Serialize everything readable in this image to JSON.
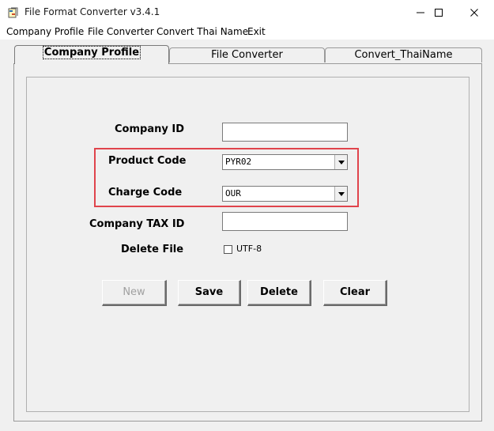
{
  "window": {
    "title": "File Format Converter v3.4.1"
  },
  "menu": [
    "Company Profile",
    "File Converter",
    "Convert Thai Name",
    "Exit"
  ],
  "tabs": [
    "Company Profile",
    "File Converter",
    "Convert_ThaiName"
  ],
  "form": {
    "company_id": {
      "label": "Company ID",
      "value": ""
    },
    "product_code": {
      "label": "Product Code",
      "value": "PYR02"
    },
    "charge_code": {
      "label": "Charge Code",
      "value": "OUR"
    },
    "company_tax_id": {
      "label": "Company TAX ID",
      "value": ""
    },
    "delete_file": {
      "label": "Delete File",
      "checkbox_label": "UTF-8",
      "checked": false
    }
  },
  "buttons": {
    "new": "New",
    "save": "Save",
    "delete": "Delete",
    "clear": "Clear"
  },
  "colors": {
    "highlight_border": "#e0444c",
    "disabled_text": "#a0a0a0"
  }
}
